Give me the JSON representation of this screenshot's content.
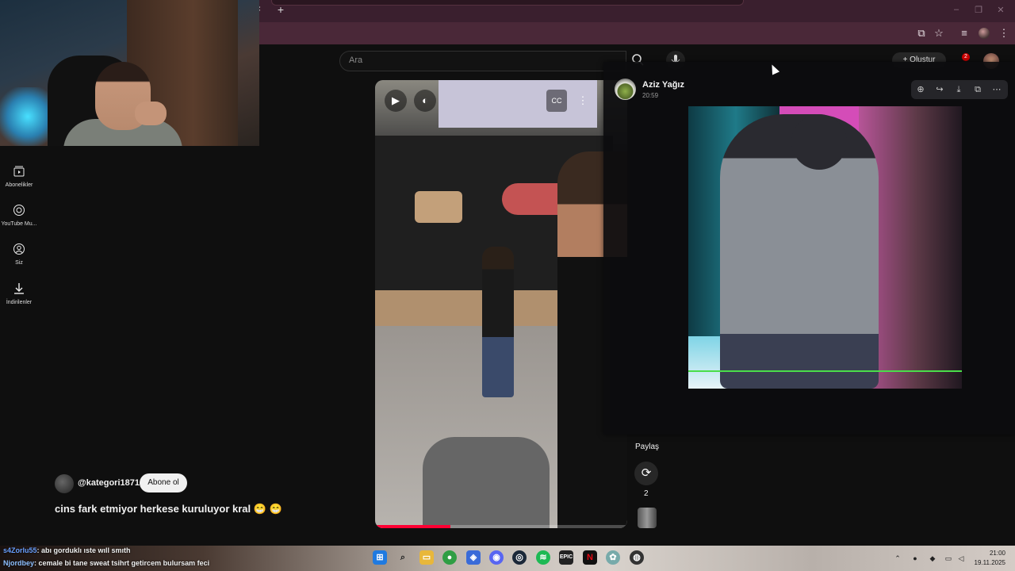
{
  "browser": {
    "new_tab_symbol": "+",
    "close_symbol": "×",
    "window_controls": [
      "–",
      "❐",
      "✕"
    ]
  },
  "youtube": {
    "search": {
      "placeholder": "Ara"
    },
    "nav": [
      {
        "label": "Abonelikler",
        "icon": "subscriptions-icon"
      },
      {
        "label": "YouTube Mu...",
        "icon": "youtube-music-icon"
      },
      {
        "label": "Siz",
        "icon": "you-icon"
      },
      {
        "label": "İndirilenler",
        "icon": "downloads-icon"
      }
    ],
    "header": {
      "create_label": "+ Oluştur",
      "notification_count": "2"
    },
    "short": {
      "channel": "@kategori1871",
      "subscribe_label": "Abone ol",
      "caption": "cins fark etmiyor herkese kuruluyor kral 😁 😁",
      "progress_percent": 30,
      "share_label": "Paylaş",
      "remix_count": "2"
    }
  },
  "telegram_viewer": {
    "sender": "Aziz Yağız",
    "time": "20:59"
  },
  "chat": [
    {
      "user": "s4Zorlu55",
      "message": ": abı gorduklı ıste wıll smıth"
    },
    {
      "user": "Njordbey",
      "message": ": cemale bi tane sweat tsihrt getircem bulursam feci"
    }
  ],
  "system": {
    "time": "21:00",
    "date": "19.11.2025"
  },
  "colors": {
    "youtube_red": "#ff0033",
    "chrome_toolbar": "#4a2838",
    "progress_green": "#4ade4a"
  }
}
